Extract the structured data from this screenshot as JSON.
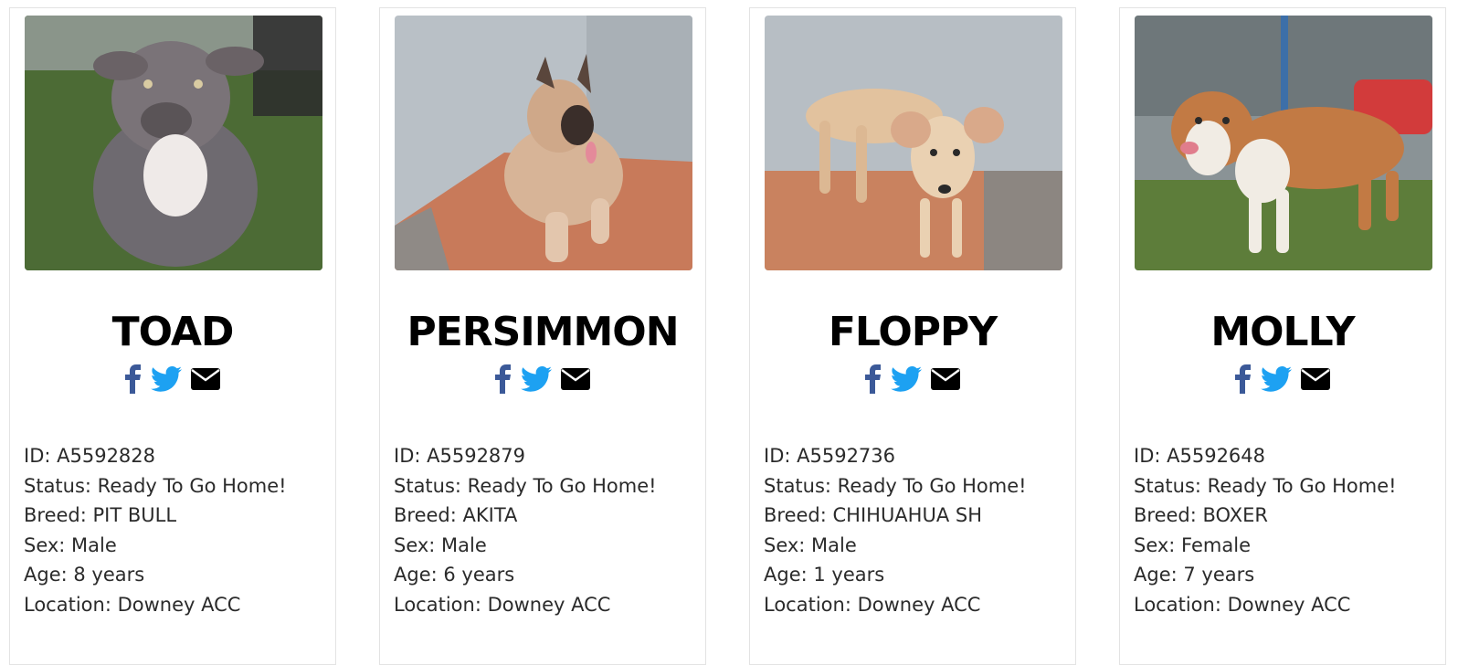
{
  "icons": {
    "facebook": "facebook-icon",
    "twitter": "twitter-icon",
    "email": "envelope-icon"
  },
  "colors": {
    "facebook": "#3b5998",
    "twitter": "#1da1f2",
    "email": "#000000",
    "name": "#000000",
    "text": "#2b2b2b",
    "card_border": "#e3e3e3"
  },
  "labels": {
    "id": "ID:",
    "status": "Status:",
    "breed": "Breed:",
    "sex": "Sex:",
    "age": "Age:",
    "location": "Location:"
  },
  "pets": [
    {
      "name": "TOAD",
      "photo": "dog-photo-gray-pit-bull-on-turf",
      "id_line": "ID: A5592828",
      "status_line": "Status: Ready To Go Home!",
      "breed_line": "Breed: PIT BULL",
      "sex_line": "Sex: Male",
      "age_line": "Age: 8 years",
      "location_line": "Location: Downey ACC"
    },
    {
      "name": "PERSIMMON",
      "photo": "dog-photo-akita-lying-on-tile",
      "id_line": "ID: A5592879",
      "status_line": "Status: Ready To Go Home!",
      "breed_line": "Breed: AKITA",
      "sex_line": "Sex: Male",
      "age_line": "Age: 6 years",
      "location_line": "Location: Downey ACC"
    },
    {
      "name": "FLOPPY",
      "photo": "dog-photo-tan-chihuahua-mix-standing",
      "id_line": "ID: A5592736",
      "status_line": "Status: Ready To Go Home!",
      "breed_line": "Breed: CHIHUAHUA SH",
      "sex_line": "Sex: Male",
      "age_line": "Age: 1 years",
      "location_line": "Location: Downey ACC"
    },
    {
      "name": "MOLLY",
      "photo": "dog-photo-boxer-by-chain-fence",
      "id_line": "ID: A5592648",
      "status_line": "Status: Ready To Go Home!",
      "breed_line": "Breed: BOXER",
      "sex_line": "Sex: Female",
      "age_line": "Age: 7 years",
      "location_line": "Location: Downey ACC"
    }
  ]
}
